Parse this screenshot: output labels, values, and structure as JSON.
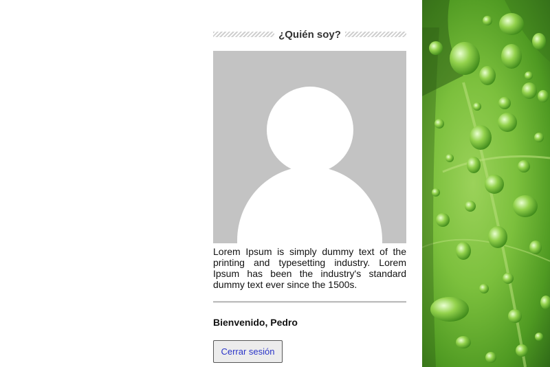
{
  "sidebar": {
    "widget_title": "¿Quién soy?",
    "bio": "Lorem Ipsum is simply dummy text of the printing and typesetting industry. Lorem Ipsum has been the industry's standard dummy text ever since the 1500s.",
    "welcome": "Bienvenido, Pedro",
    "logout_label": "Cerrar sesión"
  },
  "colors": {
    "link": "#2a34c8",
    "avatar_bg": "#c3c3c3",
    "leaf_green": "#7cc03d"
  },
  "icons": {
    "avatar": "user-silhouette-icon"
  }
}
